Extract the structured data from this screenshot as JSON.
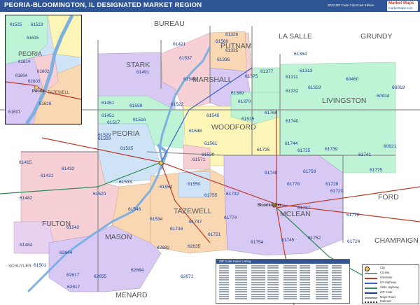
{
  "header": {
    "title": "PEORIA-BLOOMINGTON, IL DESIGNATED MARKET REGION",
    "edition": "2023 ZIP Code ColorCast Edition",
    "logo_text": "Market Maps",
    "logo_sub": "marketmaps.com"
  },
  "counties": [
    {
      "name": "BUREAU"
    },
    {
      "name": "LA SALLE"
    },
    {
      "name": "GRUNDY"
    },
    {
      "name": "PUTNAM"
    },
    {
      "name": "STARK"
    },
    {
      "name": "MARSHALL"
    },
    {
      "name": "LIVINGSTON"
    },
    {
      "name": "PEORIA"
    },
    {
      "name": "WOODFORD"
    },
    {
      "name": "TAZEWELL"
    },
    {
      "name": "MCLEAN"
    },
    {
      "name": "FORD"
    },
    {
      "name": "FULTON"
    },
    {
      "name": "MASON"
    },
    {
      "name": "CHAMPAIGN"
    },
    {
      "name": "MENARD"
    },
    {
      "name": "SCHUYLER"
    }
  ],
  "zip_labels": [
    "61421",
    "61560",
    "61326",
    "61335",
    "61537",
    "61336",
    "61491",
    "61540",
    "61375",
    "61377",
    "61369",
    "61370",
    "61364",
    "61313",
    "60460",
    "61319",
    "61332",
    "61311",
    "60934",
    "60919",
    "61451",
    "61559",
    "61522",
    "61545",
    "61760",
    "61515",
    "61516",
    "61517",
    "61548",
    "61561",
    "61740",
    "61725",
    "61725",
    "61744",
    "61739",
    "61741",
    "60921",
    "61775",
    "61415",
    "61432",
    "61431",
    "61520",
    "61482",
    "61542",
    "61529",
    "61525",
    "61533",
    "61571",
    "61530",
    "61554",
    "61550",
    "61755",
    "61732",
    "61748",
    "61753",
    "61776",
    "61728",
    "61720",
    "61546",
    "61534",
    "61734",
    "61747",
    "61721",
    "61774",
    "61737",
    "61770",
    "61752",
    "61745",
    "61754",
    "61724",
    "62644",
    "62682",
    "62635",
    "62664",
    "62655",
    "62617",
    "62671",
    "61501",
    "61484",
    "62617",
    "61451",
    "61529"
  ],
  "cities": [
    {
      "name": "Peoria"
    },
    {
      "name": "Bloomington"
    }
  ],
  "inset": {
    "zips": [
      "61525",
      "61523",
      "61614",
      "61604",
      "61603",
      "61615",
      "61607",
      "61616",
      "61602"
    ],
    "labels": [
      "PEORIA",
      "TAZEWELL"
    ],
    "city": "Peoria"
  },
  "index_panel": {
    "title": "ZIP Code Index Listing"
  },
  "legend": {
    "items": [
      "City",
      "County",
      "Interstate",
      "US Highway",
      "State Highway",
      "ZIP Code",
      "Major Road",
      "Railroad"
    ]
  },
  "colors": {
    "title_bar": "#2f5597",
    "zip_label": "#1c3d8c",
    "purple_zone": "#d8c8f4",
    "pink_zone": "#f6d0d4",
    "green_zone": "#bff3d6",
    "yellow_zone": "#fbf5b8",
    "orange_zone": "#f8d7b2",
    "blue_zone": "#cfe3f6"
  }
}
